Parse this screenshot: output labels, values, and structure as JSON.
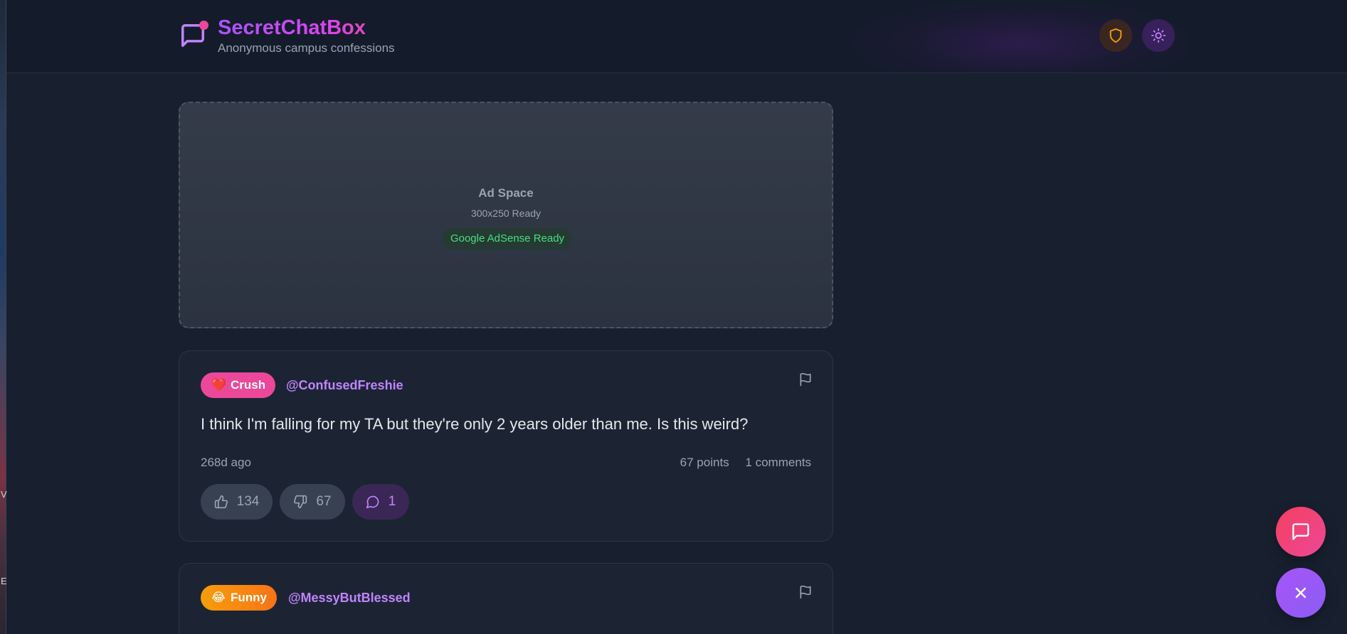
{
  "os_strip": {
    "letters": [
      "V",
      "E"
    ]
  },
  "header": {
    "brand_title": "SecretChatBox",
    "brand_subtitle": "Anonymous campus confessions",
    "icons": {
      "logo": "message-square-icon",
      "shield": "shield-icon",
      "theme": "sun-icon"
    }
  },
  "ad": {
    "title": "Ad Space",
    "size": "300x250 Ready",
    "badge": "Google AdSense Ready"
  },
  "posts": [
    {
      "tag_emoji": "❤️",
      "tag": "Crush",
      "handle": "@ConfusedFreshie",
      "text": "I think I'm falling for my TA but they're only 2 years older than me. Is this weird?",
      "time": "268d ago",
      "points": "67 points",
      "comments": "1 comments",
      "likes": "134",
      "dislikes": "67",
      "comment_count": "1"
    },
    {
      "tag_emoji": "😂",
      "tag": "Funny",
      "handle": "@MessyButBlessed"
    }
  ],
  "colors": {
    "accent_purple": "#a855f7",
    "accent_pink": "#ec4899",
    "background": "#182030",
    "success": "#4ade80"
  }
}
